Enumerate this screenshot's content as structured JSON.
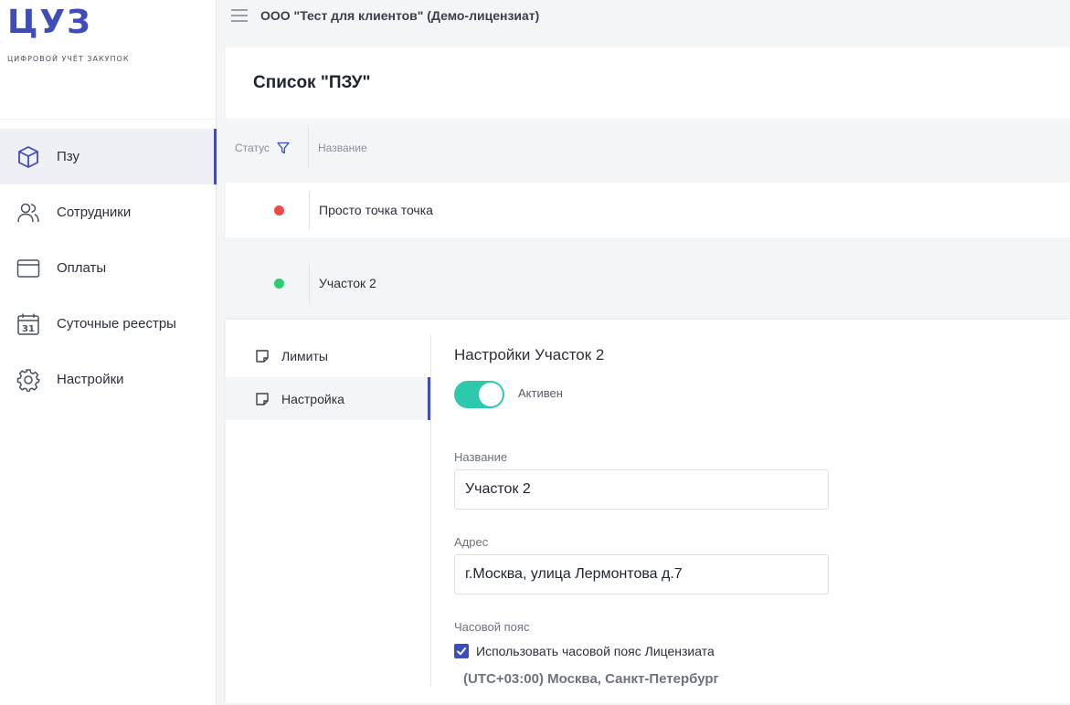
{
  "app": {
    "logo": "ЦУЗ",
    "logo_subtitle": "ЦИФРОВОЙ УЧЁТ ЗАКУПОК"
  },
  "colors": {
    "accent": "#3f4db8",
    "active_status": "#2ecc71",
    "inactive_status": "#f04848",
    "toggle_on": "#2cc9ad"
  },
  "sidebar": {
    "items": [
      {
        "label": "Пзу",
        "icon": "cube-icon",
        "active": true
      },
      {
        "label": "Сотрудники",
        "icon": "users-icon",
        "active": false
      },
      {
        "label": "Оплаты",
        "icon": "credit-card-icon",
        "active": false
      },
      {
        "label": "Суточные реестры",
        "icon": "calendar-icon",
        "active": false
      },
      {
        "label": "Настройки",
        "icon": "gear-icon",
        "active": false
      }
    ]
  },
  "topbar": {
    "organization": "ООО \"Тест для клиентов\" (Демо-лицензиат)"
  },
  "list": {
    "title": "Список \"ПЗУ\"",
    "columns": {
      "status": "Статус",
      "name": "Название"
    },
    "rows": [
      {
        "name": "Просто точка точка",
        "status": "inactive"
      },
      {
        "name": "Участок 2",
        "status": "active"
      }
    ]
  },
  "detail": {
    "tabs": [
      {
        "label": "Лимиты",
        "icon": "note-icon",
        "active": false
      },
      {
        "label": "Настройка",
        "icon": "note-icon",
        "active": true
      }
    ],
    "title": "Настройки Участок 2",
    "toggle": {
      "label": "Активен",
      "on": true
    },
    "name_field": {
      "label": "Название",
      "value": "Участок 2"
    },
    "address_field": {
      "label": "Адрес",
      "value": "г.Москва, улица Лермонтова д.7"
    },
    "timezone": {
      "label": "Часовой пояс",
      "checkbox_label": "Использовать часовой пояс Лицензиата",
      "checked": true,
      "value": "(UTC+03:00) Москва, Санкт-Петербург"
    }
  }
}
